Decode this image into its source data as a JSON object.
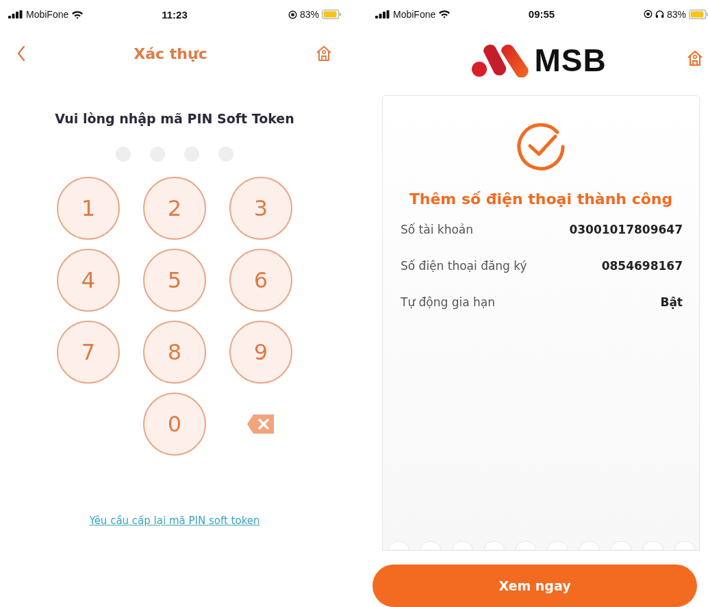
{
  "screens": [
    {
      "status_bar": {
        "carrier": "MobiFone",
        "time": "11:23",
        "battery": "83%",
        "headphones": false
      },
      "header": {
        "title": "Xác thực"
      },
      "prompt": "Vui lòng nhập mã PIN Soft Token",
      "pin_dots": [
        {
          "filled": false
        },
        {
          "filled": false
        },
        {
          "filled": false
        },
        {
          "filled": false
        }
      ],
      "keypad": [
        {
          "kind": "digit",
          "label": "1"
        },
        {
          "kind": "digit",
          "label": "2"
        },
        {
          "kind": "digit",
          "label": "3"
        },
        {
          "kind": "digit",
          "label": "4"
        },
        {
          "kind": "digit",
          "label": "5"
        },
        {
          "kind": "digit",
          "label": "6"
        },
        {
          "kind": "digit",
          "label": "7"
        },
        {
          "kind": "digit",
          "label": "8"
        },
        {
          "kind": "digit",
          "label": "9"
        },
        {
          "kind": "blank"
        },
        {
          "kind": "digit",
          "label": "0"
        },
        {
          "kind": "delete"
        }
      ],
      "link": "Yêu cầu cấp lại mã PIN soft token"
    },
    {
      "status_bar": {
        "carrier": "MobiFone",
        "time": "09:55",
        "battery": "83%",
        "headphones": true
      },
      "logo": "MSB",
      "result": {
        "title": "Thêm số điện thoại thành công",
        "rows": [
          {
            "label": "Số tài khoản",
            "value": "03001017809647"
          },
          {
            "label": "Số điện thoại đăng ký",
            "value": "0854698167"
          },
          {
            "label": "Tự động gia hạn",
            "value": "Bật"
          }
        ]
      },
      "button": "Xem ngay"
    }
  ]
}
